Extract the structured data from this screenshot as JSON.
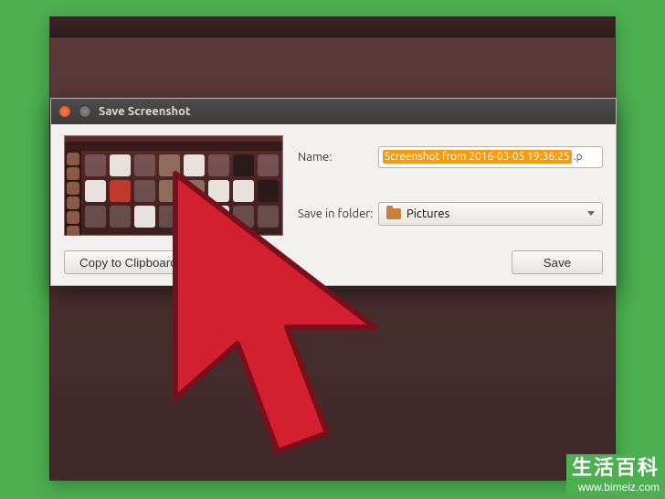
{
  "dialog": {
    "title": "Save Screenshot",
    "name_label": "Name:",
    "filename_selected": "Screenshot from 2016-03-05 19:36:25",
    "filename_ext": ".p",
    "folder_label": "Save in folder:",
    "folder_value": "Pictures",
    "copy_button": "Copy to Clipboard",
    "save_button": "Save"
  },
  "watermark": {
    "cn": "生活百科",
    "url": "www.bimeiz.com"
  }
}
